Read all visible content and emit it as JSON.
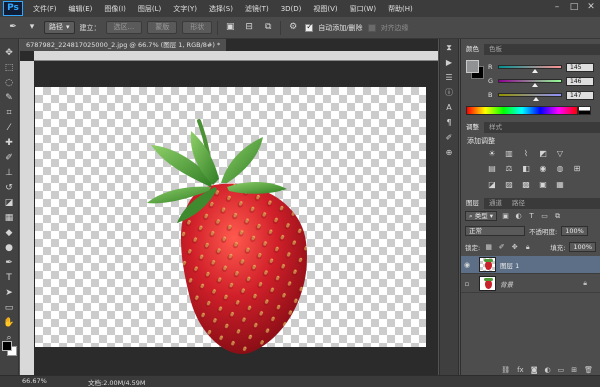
{
  "app": {
    "logo": "Ps"
  },
  "menu": [
    "文件(F)",
    "编辑(E)",
    "图像(I)",
    "图层(L)",
    "文字(Y)",
    "选择(S)",
    "滤镜(T)",
    "3D(D)",
    "视图(V)",
    "窗口(W)",
    "帮助(H)"
  ],
  "options": {
    "mode": "路径",
    "build_label": "建立：",
    "selection_btn": "选区...",
    "mask_btn": "蒙版",
    "shape_btn": "形状",
    "auto_add_delete": "自动添加/删除",
    "auto_add_checked": true,
    "align_edges": "对齐边缘"
  },
  "document": {
    "tab_title": "6787982_224817025000_2.jpg @ 66.7% (图层 1, RGB/8#) *",
    "zoom": "66.67%",
    "size": "文档:2.00M/4.59M"
  },
  "color_panel": {
    "tabs": [
      "颜色",
      "色板"
    ],
    "active_tab": "颜色",
    "r": "145",
    "g": "146",
    "b": "147",
    "r_fraction": 0.57,
    "g_fraction": 0.57,
    "b_fraction": 0.58,
    "fg_color": "#919293",
    "bg_color": "#000000"
  },
  "adjustments": {
    "tabs": [
      "调整",
      "样式"
    ],
    "active_tab": "调整",
    "title": "添加调整"
  },
  "layers": {
    "tabs": [
      "图层",
      "通道",
      "路径"
    ],
    "active_tab": "图层",
    "filter_kind": "类型",
    "blend_mode": "正常",
    "opacity_label": "不透明度:",
    "opacity": "100%",
    "lock_label": "锁定:",
    "fill_label": "填充:",
    "fill": "100%",
    "items": [
      {
        "name": "图层 1",
        "selected": true,
        "visible": true
      },
      {
        "name": "背景",
        "selected": false,
        "visible": false,
        "locked": true
      }
    ]
  },
  "colors": {
    "ps_accent": "#31a8ff",
    "selection": "#5d6f86",
    "strawberry": "#c8232a",
    "leaf": "#4e9a3a"
  }
}
